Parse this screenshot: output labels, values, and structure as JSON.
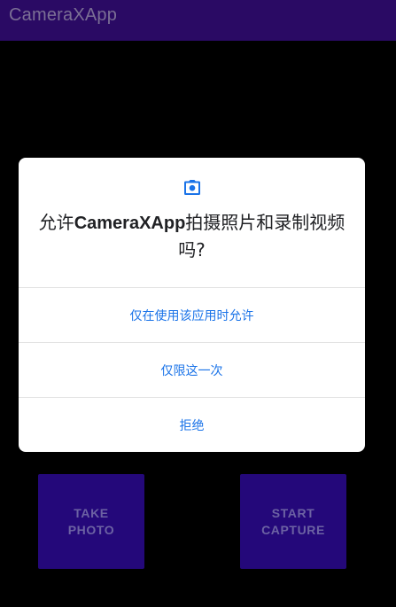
{
  "app_bar": {
    "title": "CameraXApp"
  },
  "dialog": {
    "icon": "camera-icon",
    "message_prefix": "允许",
    "message_app": "CameraXApp",
    "message_suffix": "拍摄照片和录制视频吗?",
    "options": [
      {
        "label": "仅在使用该应用时允许"
      },
      {
        "label": "仅限这一次"
      },
      {
        "label": "拒绝"
      }
    ]
  },
  "buttons": {
    "take_photo_line1": "TAKE",
    "take_photo_line2": "PHOTO",
    "start_capture_line1": "START",
    "start_capture_line2": "CAPTURE"
  },
  "colors": {
    "app_bar": "#2a0a64",
    "button": "#24087a",
    "accent": "#1a73e8"
  }
}
